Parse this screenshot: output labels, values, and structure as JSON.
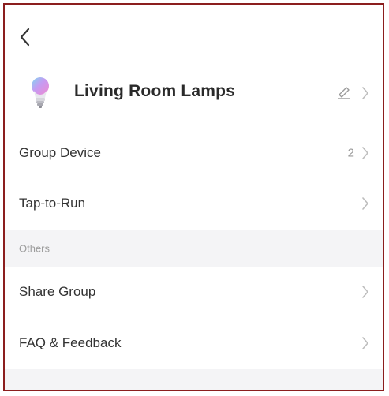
{
  "device": {
    "name": "Living Room Lamps"
  },
  "rows": {
    "group_device": {
      "label": "Group Device",
      "count": "2"
    },
    "tap_to_run": {
      "label": "Tap-to-Run"
    },
    "others_section": {
      "label": "Others"
    },
    "share_group": {
      "label": "Share Group"
    },
    "faq_feedback": {
      "label": "FAQ & Feedback"
    }
  },
  "icons": {
    "back": "back-chevron-icon",
    "bulb": "smart-bulb-icon",
    "edit": "pencil-icon",
    "chevron": "chevron-right-icon"
  },
  "colors": {
    "frame_border": "#8b1e1e",
    "section_bg": "#f4f4f6",
    "text_primary": "#333333",
    "text_muted": "#9a9a9a"
  }
}
